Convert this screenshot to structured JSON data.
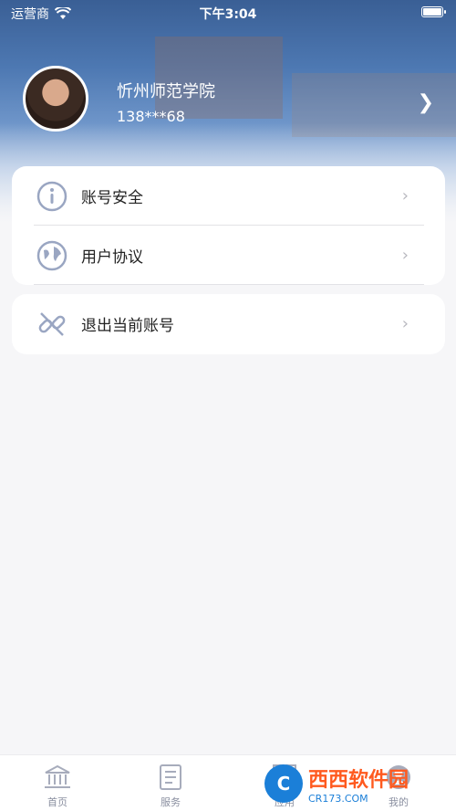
{
  "status_bar": {
    "carrier": "运营商",
    "time": "下午3:04"
  },
  "profile": {
    "name": "忻州师范学院",
    "phone": "138***68"
  },
  "menu": {
    "items": [
      {
        "label": "账号安全",
        "icon": "info-icon"
      },
      {
        "label": "用户协议",
        "icon": "globe-icon"
      }
    ],
    "logout": {
      "label": "退出当前账号",
      "icon": "unlink-icon"
    }
  },
  "tabbar": {
    "tabs": [
      {
        "label": "首页",
        "icon": "bank-icon"
      },
      {
        "label": "服务",
        "icon": "document-list-icon"
      },
      {
        "label": "应用",
        "icon": "grid-icon"
      },
      {
        "label": "我的",
        "icon": "user-icon"
      }
    ]
  },
  "watermark": {
    "main": "西西软件园",
    "sub": "CR173.COM",
    "logo_text": "C"
  },
  "colors": {
    "header_top": "#3a5f95",
    "accent_icon": "#9aa6c2",
    "chevron": "#b8b8bf",
    "watermark_orange": "#ff5a1f",
    "watermark_blue": "#1b7fd8"
  }
}
